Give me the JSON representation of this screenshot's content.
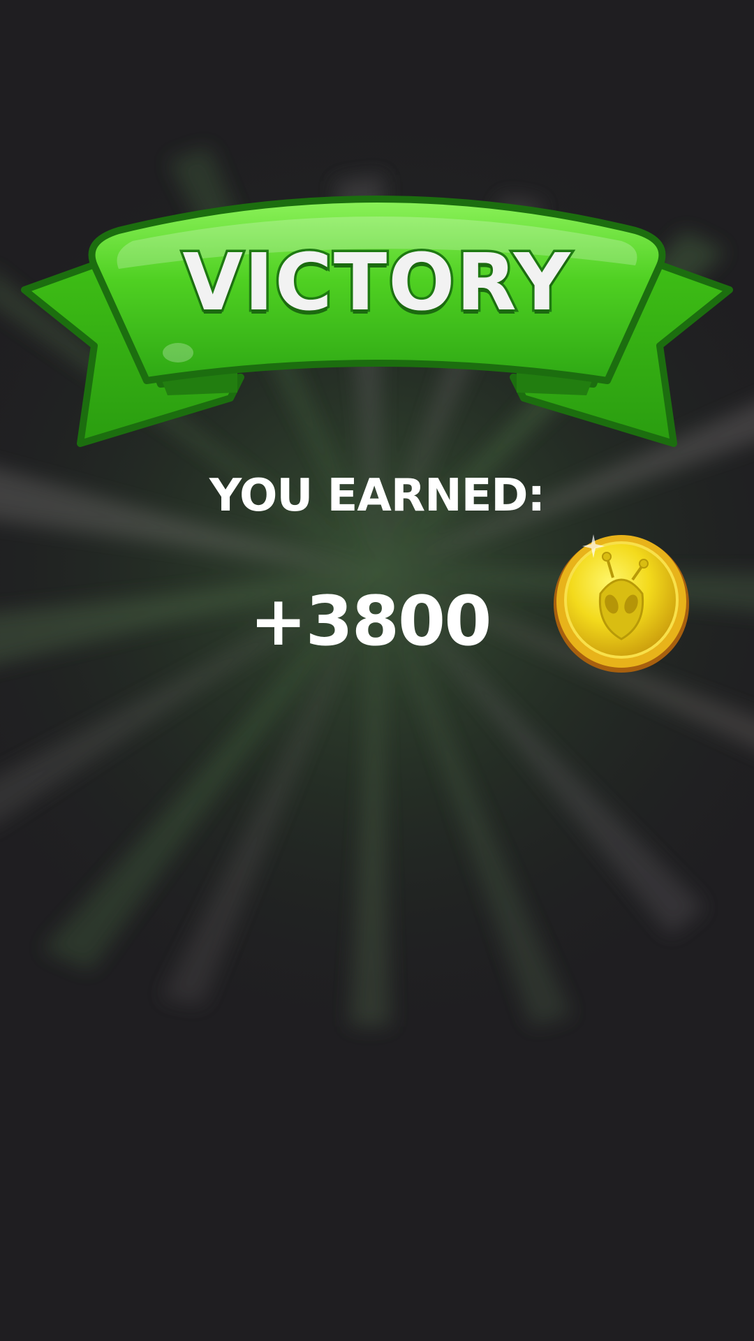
{
  "screen": "victory",
  "banner": {
    "title": "VICTORY"
  },
  "reward": {
    "label": "YOU EARNED:",
    "amount": "+3800",
    "currency_icon": "alien-coin-icon"
  },
  "colors": {
    "background": "#1f1e21",
    "ribbon_green": "#3fc21a",
    "ribbon_dark": "#1f7a12",
    "coin_gold": "#f2d62a",
    "text": "#ffffff"
  }
}
